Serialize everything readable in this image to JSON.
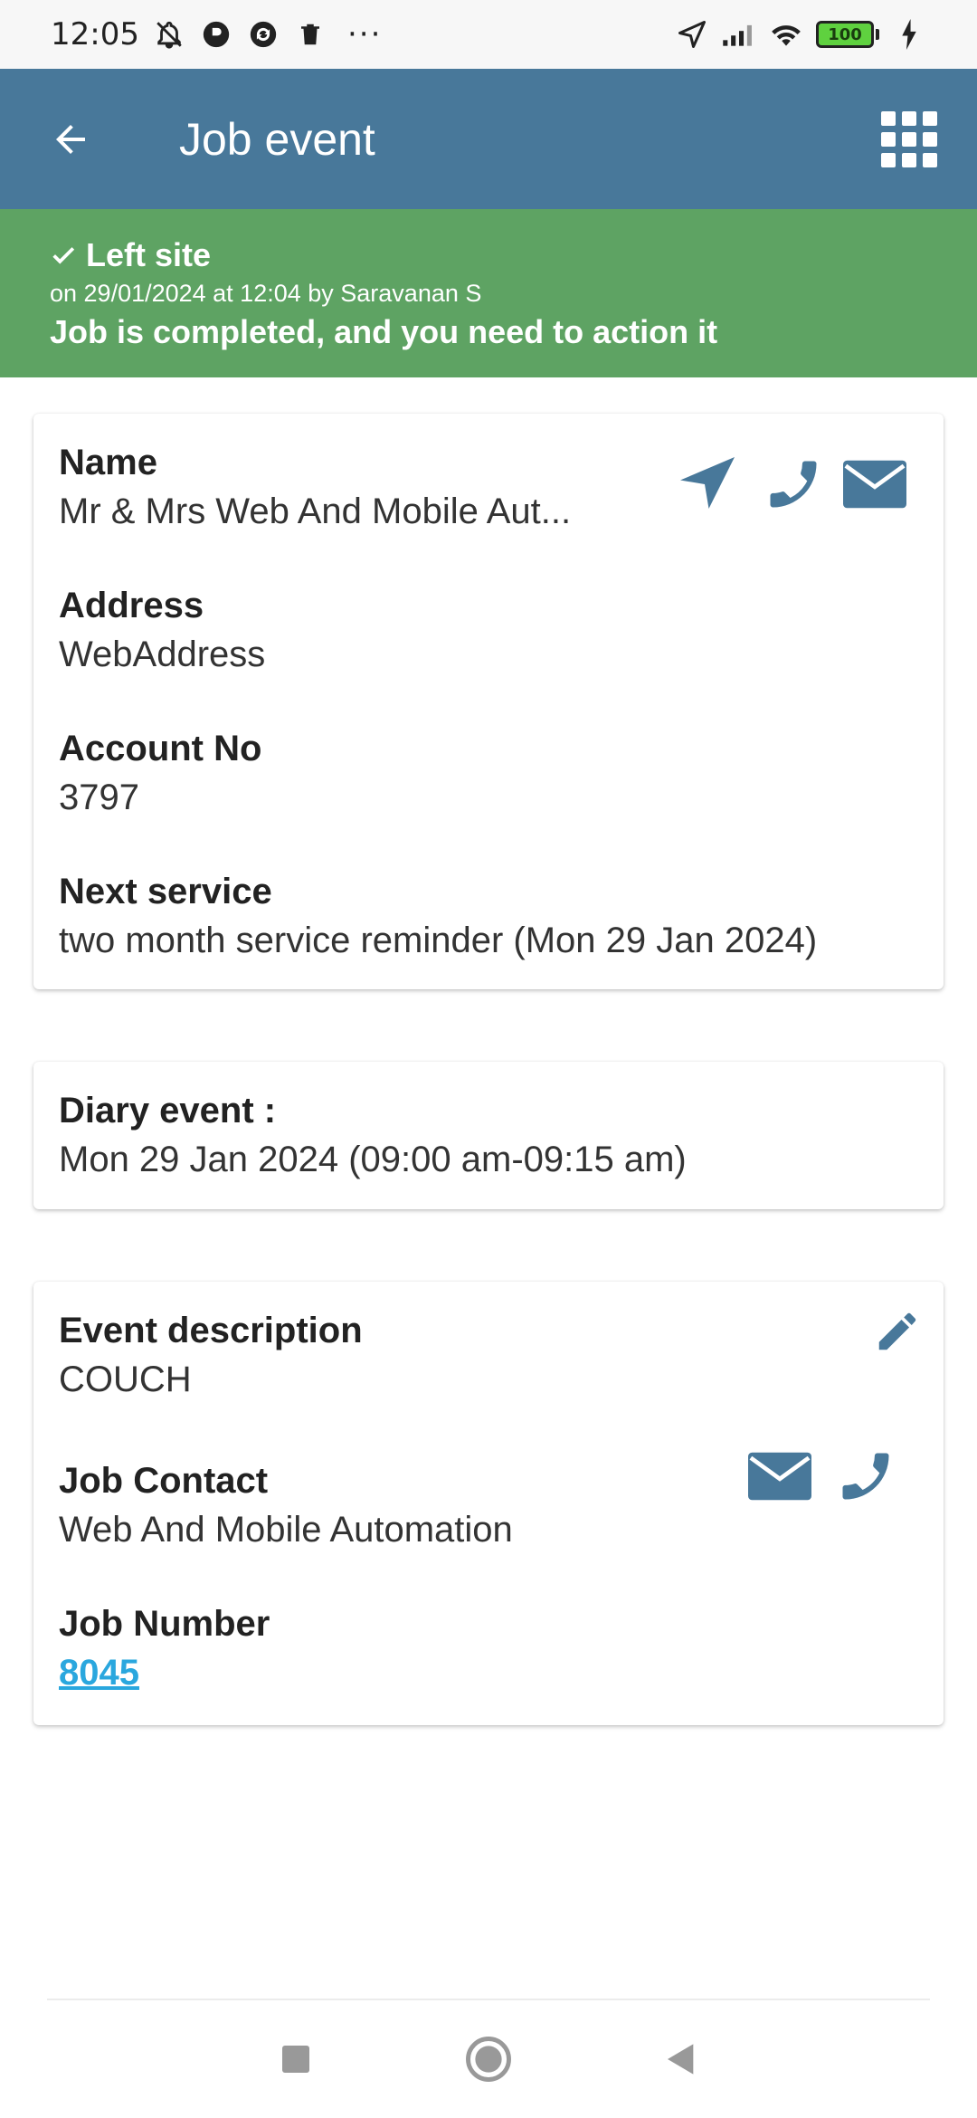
{
  "status_bar": {
    "time": "12:05",
    "battery": "100",
    "more": "···"
  },
  "app_bar": {
    "title": "Job event",
    "icons": [
      "arrow-left-icon",
      "grid-menu-icon"
    ]
  },
  "banner": {
    "status": "Left site",
    "meta": "on 29/01/2024 at 12:04 by Saravanan S",
    "message": "Job is completed, and you need to action it",
    "color": "#5ea363"
  },
  "customer_card": {
    "name_label": "Name",
    "name_value": "Mr & Mrs Web And Mobile Aut...",
    "address_label": "Address",
    "address_value": "WebAddress",
    "account_label": "Account No",
    "account_value": "3797",
    "next_service_label": "Next service",
    "next_service_value": "two month service reminder (Mon 29 Jan 2024)"
  },
  "diary_card": {
    "label": "Diary event :",
    "value": "Mon 29 Jan 2024 (09:00 am-09:15 am)"
  },
  "event_card": {
    "description_label": "Event description",
    "description_value": "COUCH",
    "contact_label": "Job Contact",
    "contact_value": "Web And Mobile Automation",
    "job_number_label": "Job Number",
    "job_number_value": "8045"
  },
  "colors": {
    "app_bar": "#48789a",
    "icon": "#48789a",
    "link": "#2aa7de"
  }
}
